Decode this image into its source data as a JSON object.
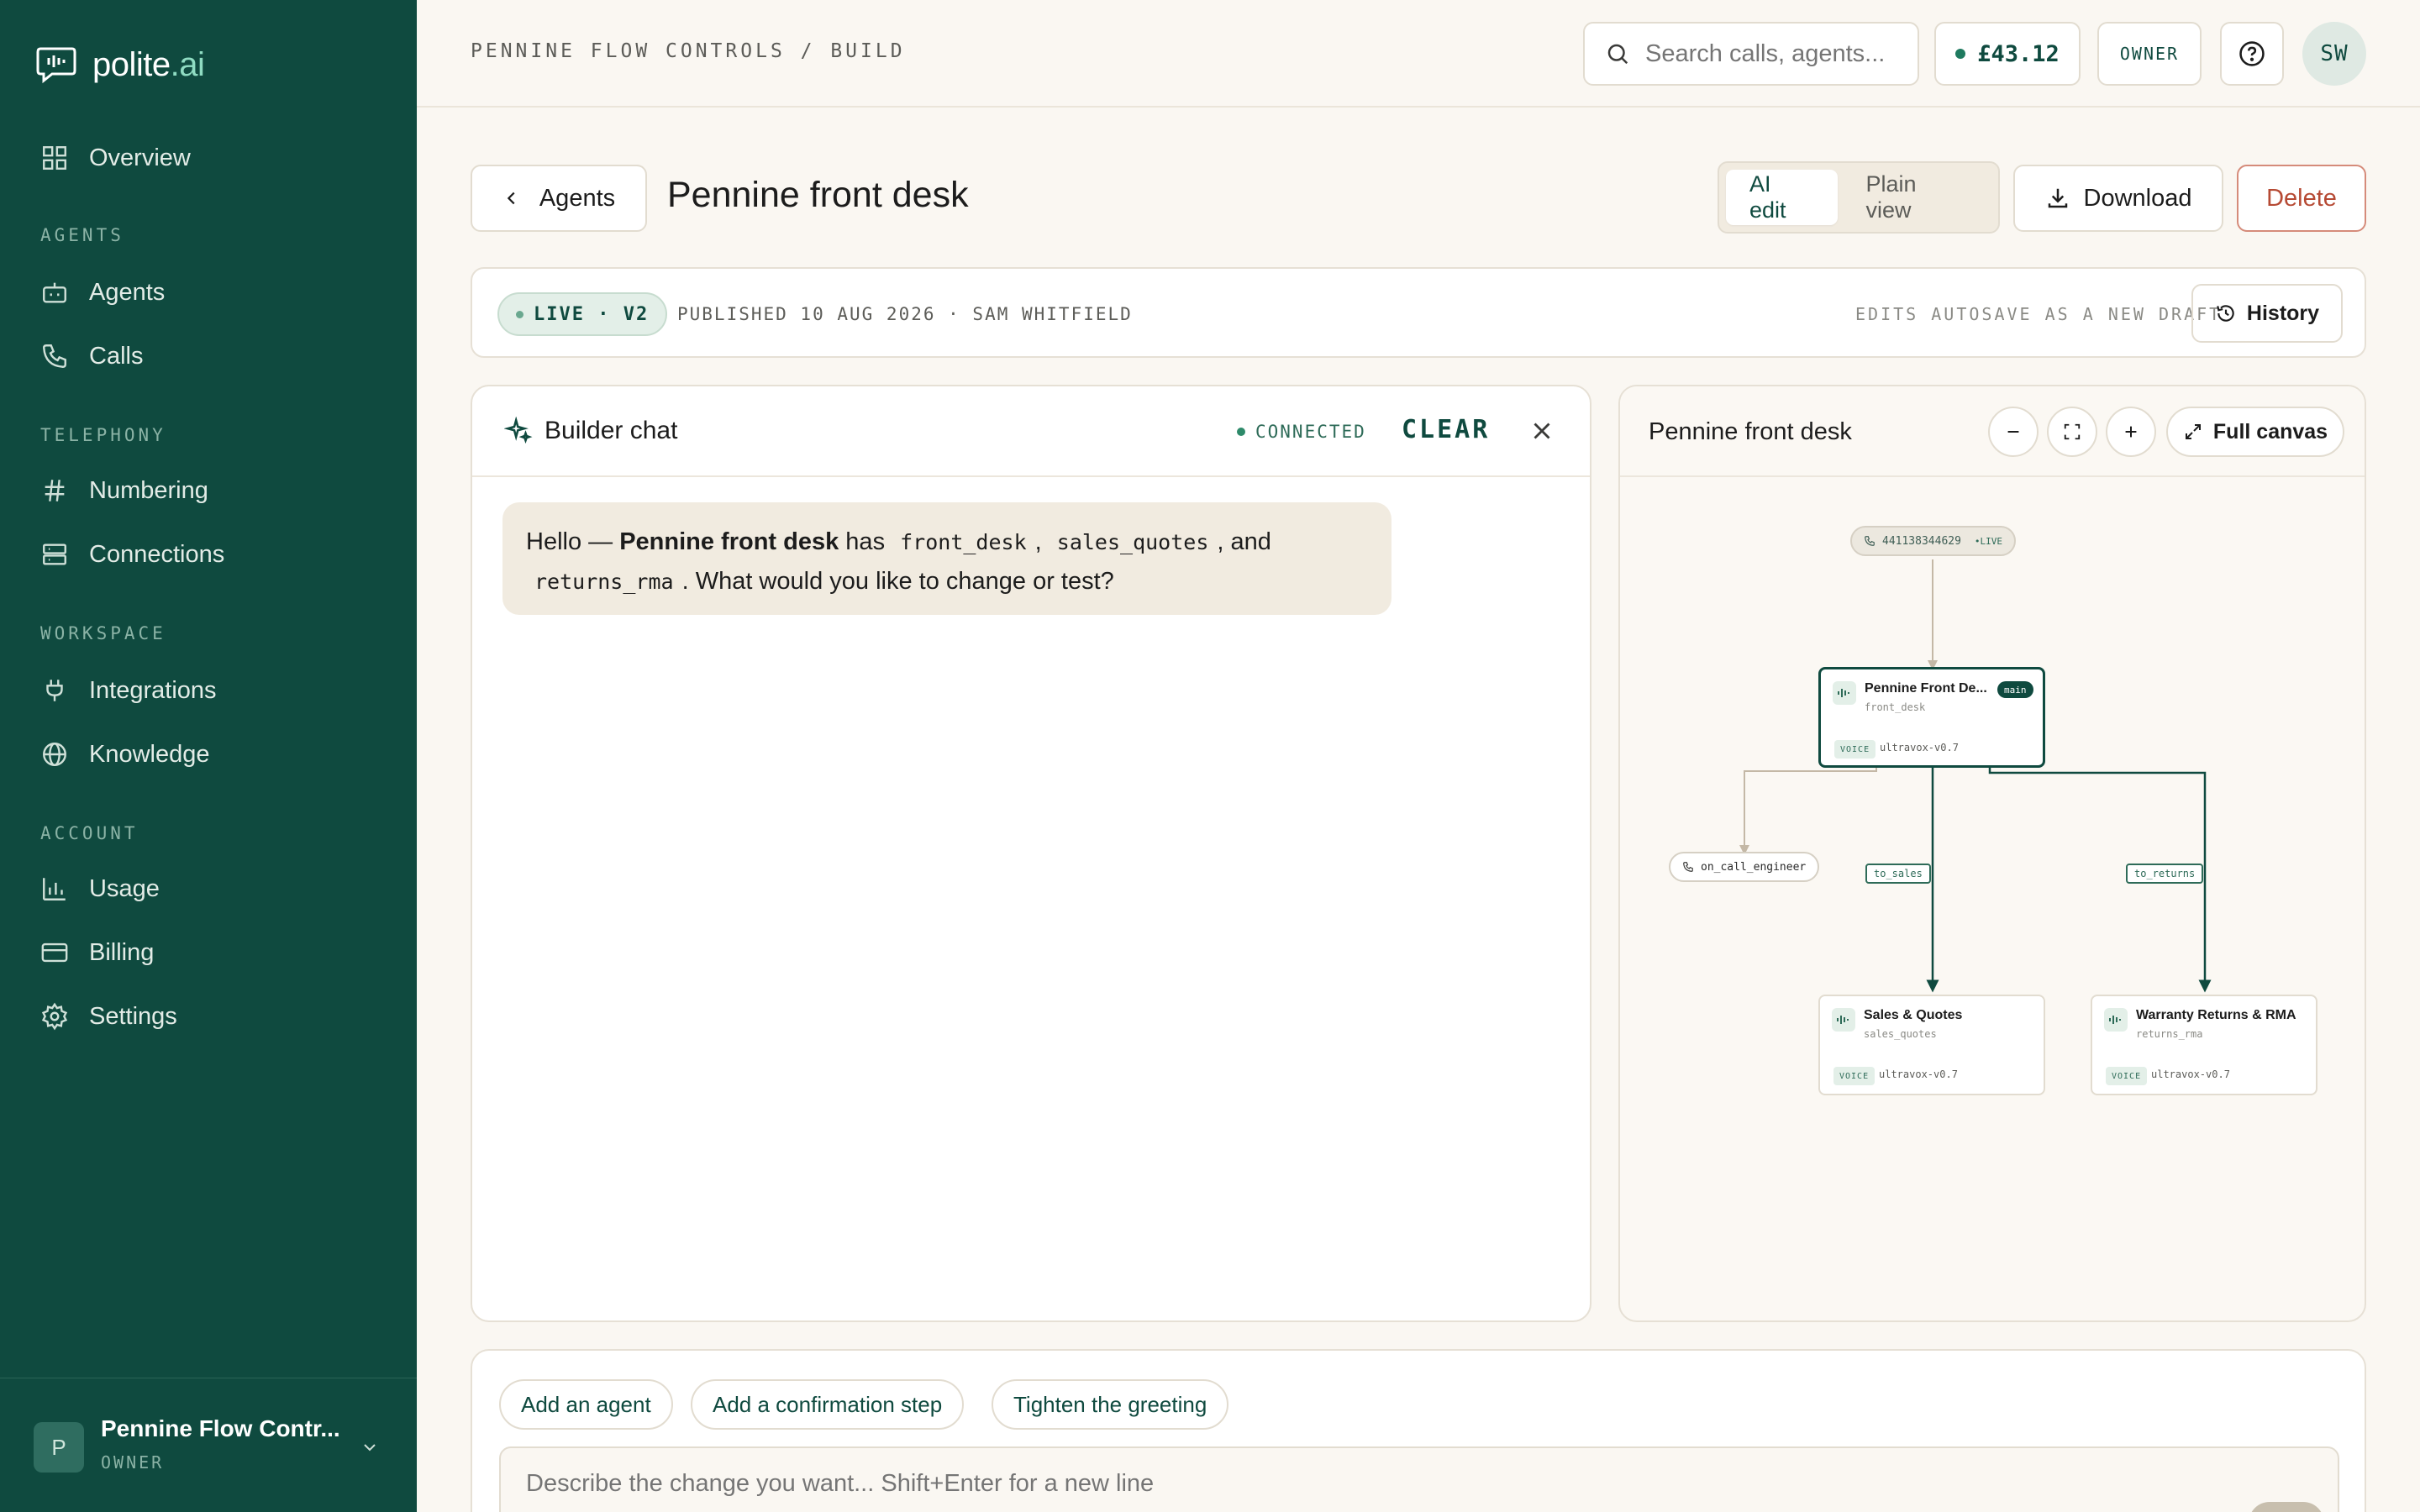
{
  "brand": {
    "name": "polite",
    "suffix": ".ai"
  },
  "sidebar": {
    "overview": "Overview",
    "sections": {
      "agents": "AGENTS",
      "telephony": "TELEPHONY",
      "workspace": "WORKSPACE",
      "account": "ACCOUNT"
    },
    "items": {
      "agents": "Agents",
      "calls": "Calls",
      "numbering": "Numbering",
      "connections": "Connections",
      "integrations": "Integrations",
      "knowledge": "Knowledge",
      "usage": "Usage",
      "billing": "Billing",
      "settings": "Settings"
    },
    "org": {
      "initial": "P",
      "name": "Pennine Flow Contr...",
      "role": "OWNER"
    }
  },
  "header": {
    "breadcrumb": "PENNINE FLOW CONTROLS / BUILD",
    "search_placeholder": "Search calls, agents...",
    "balance": "£43.12",
    "role": "OWNER",
    "user_initials": "SW"
  },
  "page": {
    "back_label": "Agents",
    "title": "Pennine front desk",
    "view_modes": [
      "AI edit",
      "Plain view"
    ],
    "active_view": "AI edit",
    "download_label": "Download",
    "delete_label": "Delete"
  },
  "status": {
    "badge": "LIVE · V2",
    "published": "PUBLISHED 10 AUG 2026 · SAM WHITFIELD",
    "autosave": "EDITS AUTOSAVE AS A NEW DRAFT",
    "history_label": "History"
  },
  "chat": {
    "title": "Builder chat",
    "connection": "CONNECTED",
    "clear_label": "CLEAR",
    "message": {
      "prefix": "Hello — ",
      "agent_name": "Pennine front desk",
      "has": " has ",
      "code1": "front_desk",
      "sep1": ", ",
      "code2": "sales_quotes",
      "and": ", and",
      "code3": "returns_rma",
      "suffix": ". What would you like to change or test?"
    }
  },
  "canvas": {
    "title": "Pennine front desk",
    "full_canvas_label": "Full canvas",
    "phone_node": {
      "number": "441138344629",
      "status": "•LIVE"
    },
    "transfer_node": "on_call_engineer",
    "edge_labels": [
      "to_sales",
      "to_returns"
    ],
    "agents": [
      {
        "name": "Pennine Front De...",
        "slug": "front_desk",
        "tag": "main",
        "type": "VOICE",
        "model": "ultravox-v0.7"
      },
      {
        "name": "Sales & Quotes",
        "slug": "sales_quotes",
        "type": "VOICE",
        "model": "ultravox-v0.7"
      },
      {
        "name": "Warranty Returns & RMA",
        "slug": "returns_rma",
        "type": "VOICE",
        "model": "ultravox-v0.7"
      }
    ]
  },
  "composer": {
    "suggestions": [
      "Add an agent",
      "Add a confirmation step",
      "Tighten the greeting"
    ],
    "placeholder": "Describe the change you want... Shift+Enter for a new line"
  },
  "colors": {
    "sidebar_bg": "#0f4a3f",
    "accent": "#0f4a3f",
    "danger": "#b64a34",
    "page_bg": "#faf7f2"
  }
}
